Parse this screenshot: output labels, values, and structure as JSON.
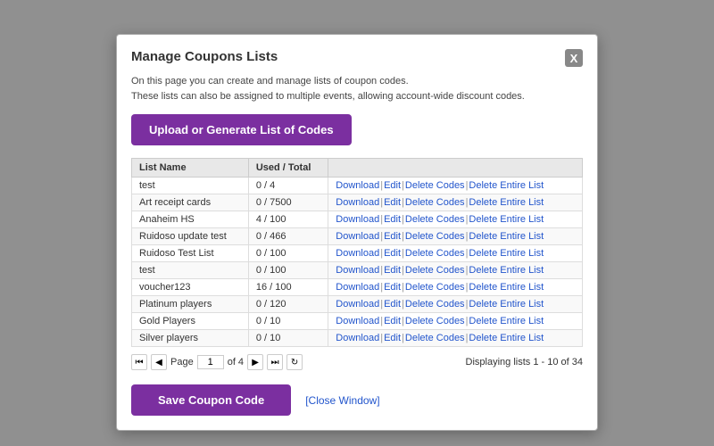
{
  "modal": {
    "title": "Manage Coupons Lists",
    "description_line1": "On this page you can create and manage lists of coupon codes.",
    "description_line2": "These lists can also be assigned to multiple events, allowing account-wide discount codes.",
    "upload_button_label": "Upload or Generate List of Codes",
    "close_button_label": "X",
    "table": {
      "headers": [
        "List Name",
        "Used / Total",
        ""
      ],
      "rows": [
        {
          "name": "test",
          "used_total": "0 / 4"
        },
        {
          "name": "Art receipt cards",
          "used_total": "0 / 7500"
        },
        {
          "name": "Anaheim HS",
          "used_total": "4 / 100"
        },
        {
          "name": "Ruidoso update test",
          "used_total": "0 / 466"
        },
        {
          "name": "Ruidoso Test List",
          "used_total": "0 / 100"
        },
        {
          "name": "test",
          "used_total": "0 / 100"
        },
        {
          "name": "voucher123",
          "used_total": "16 / 100"
        },
        {
          "name": "Platinum players",
          "used_total": "0 / 120"
        },
        {
          "name": "Gold Players",
          "used_total": "0 / 10"
        },
        {
          "name": "Silver players",
          "used_total": "0 / 10"
        }
      ],
      "actions": {
        "download": "Download",
        "edit": "Edit",
        "delete_codes": "Delete Codes",
        "delete_entire": "Delete Entire List"
      }
    },
    "pagination": {
      "page_label": "Page",
      "current_page": "1",
      "of_label": "of 4",
      "displaying": "Displaying lists 1 - 10 of 34"
    },
    "footer": {
      "save_label": "Save Coupon Code",
      "close_window_label": "[Close Window]"
    }
  }
}
